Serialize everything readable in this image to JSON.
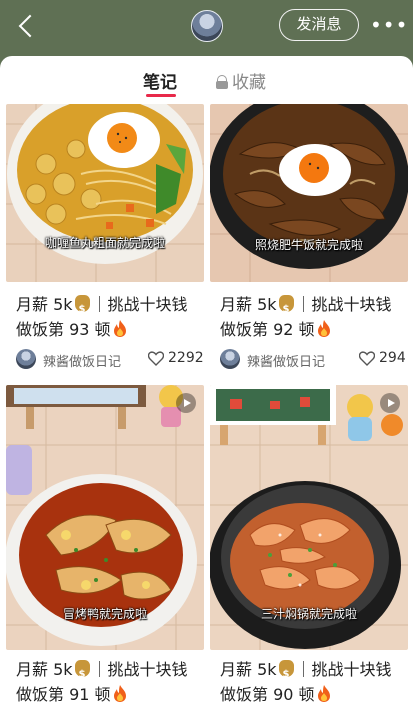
{
  "header": {
    "back_icon": "chevron-left-icon",
    "message_button": "发消息",
    "more_icon": "more-dots-icon",
    "more_label": "•••"
  },
  "tabs": {
    "notes": "笔记",
    "favorites": "收藏",
    "favorites_icon": "lock-icon",
    "active_color": "#e8294a"
  },
  "cards": [
    {
      "caption": "咖喱鱼丸粗面就完成啦",
      "title_prefix": "月薪 5k",
      "title_mid": "｜挑战十块钱",
      "title_line2": "做饭第 93 顿",
      "author": "辣酱做饭日记",
      "likes": "2292",
      "is_video": false
    },
    {
      "caption": "照烧肥牛饭就完成啦",
      "title_prefix": "月薪 5k",
      "title_mid": "｜挑战十块钱",
      "title_line2": "做饭第 92 顿",
      "author": "辣酱做饭日记",
      "likes": "294",
      "is_video": false
    },
    {
      "caption": "冒烤鸭就完成啦",
      "title_prefix": "月薪 5k",
      "title_mid": "｜挑战十块钱",
      "title_line2": "做饭第 91 顿",
      "is_video": true
    },
    {
      "caption": "三汁焖锅就完成啦",
      "title_prefix": "月薪 5k",
      "title_mid": "｜挑战十块钱",
      "title_line2": "做饭第 90 顿",
      "is_video": true
    }
  ],
  "colors": {
    "header_bg": "#5f7054",
    "accent": "#e8294a"
  }
}
